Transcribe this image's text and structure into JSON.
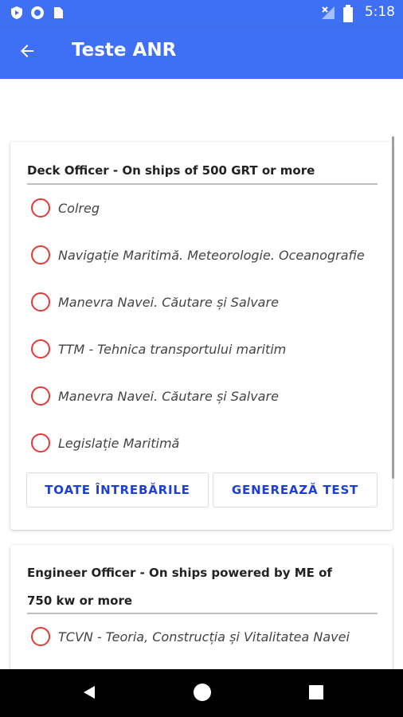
{
  "status_bar": {
    "time": "5:18",
    "left_icons": [
      "shield-play-icon",
      "record-icon",
      "sim-card-icon"
    ],
    "right_icons": [
      "no-signal-icon",
      "battery-icon"
    ]
  },
  "app_bar": {
    "title": "Teste ANR",
    "back_icon": "arrow-left-icon"
  },
  "cards": [
    {
      "title": "Deck Officer - On ships of 500 GRT or more",
      "options": [
        "Colreg",
        "Navigație Maritimă. Meteorologie. Oceanografie",
        "Manevra Navei. Căutare și Salvare",
        "TTM - Tehnica transportului maritim",
        "Manevra Navei. Căutare și Salvare",
        "Legislație Maritimă"
      ],
      "buttons": {
        "all_questions": "TOATE ÎNTREBĂRILE",
        "generate_test": "GENEREAZĂ TEST"
      }
    },
    {
      "title_line1": "Engineer Officer - On ships powered by ME of",
      "title_line2": "750 kw or more",
      "options": [
        "TCVN - Teoria, Construcția și Vitalitatea Navei"
      ]
    }
  ],
  "nav_bar": {
    "icons": [
      "back-triangle-icon",
      "home-circle-icon",
      "recents-square-icon"
    ]
  },
  "colors": {
    "primary": "#3f6ff3",
    "radio": "#e53935",
    "button_text": "#1e3fd6"
  }
}
